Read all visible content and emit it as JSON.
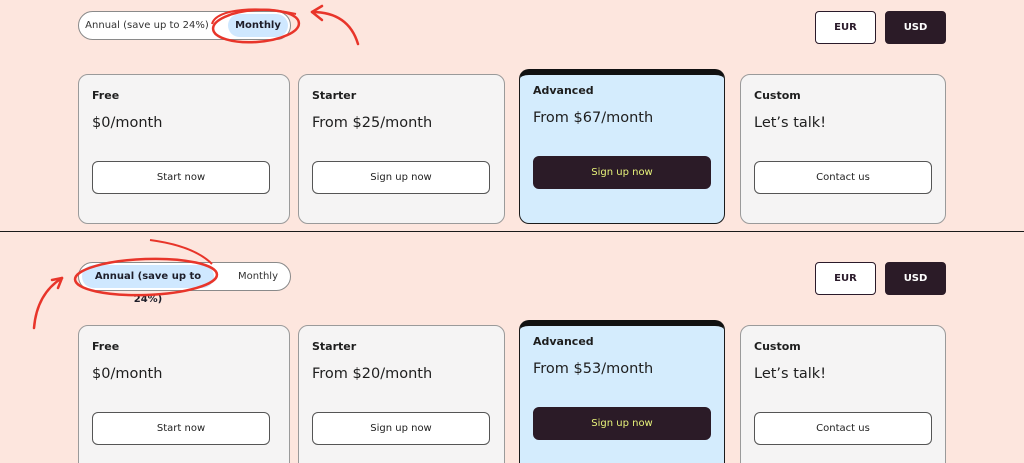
{
  "panels": [
    {
      "billing_toggle": {
        "annual_label": "Annual (save up to 24%)",
        "monthly_label": "Monthly",
        "selected": "monthly"
      },
      "currency": {
        "eur_label": "EUR",
        "usd_label": "USD",
        "selected": "USD"
      },
      "plans": [
        {
          "name": "Free",
          "price": "$0/month",
          "cta": "Start now"
        },
        {
          "name": "Starter",
          "price": "From $25/month",
          "cta": "Sign up now"
        },
        {
          "name": "Advanced",
          "price": "From $67/month",
          "cta": "Sign up now"
        },
        {
          "name": "Custom",
          "price": "Let’s talk!",
          "cta": "Contact us"
        }
      ]
    },
    {
      "billing_toggle": {
        "annual_label": "Annual (save up to 24%)",
        "monthly_label": "Monthly",
        "selected": "annual"
      },
      "currency": {
        "eur_label": "EUR",
        "usd_label": "USD",
        "selected": "USD"
      },
      "plans": [
        {
          "name": "Free",
          "price": "$0/month",
          "cta": "Start now"
        },
        {
          "name": "Starter",
          "price": "From $20/month",
          "cta": "Sign up now"
        },
        {
          "name": "Advanced",
          "price": "From $53/month",
          "cta": "Sign up now"
        },
        {
          "name": "Custom",
          "price": "Let’s talk!",
          "cta": "Contact us"
        }
      ]
    }
  ],
  "colors": {
    "background": "#fde6de",
    "accent_dark": "#2b1b27",
    "highlight": "#cfe8ff",
    "annotation": "#e8352a",
    "advanced_card": "#d4ecfd",
    "advanced_cta_text": "#e7f37a"
  }
}
